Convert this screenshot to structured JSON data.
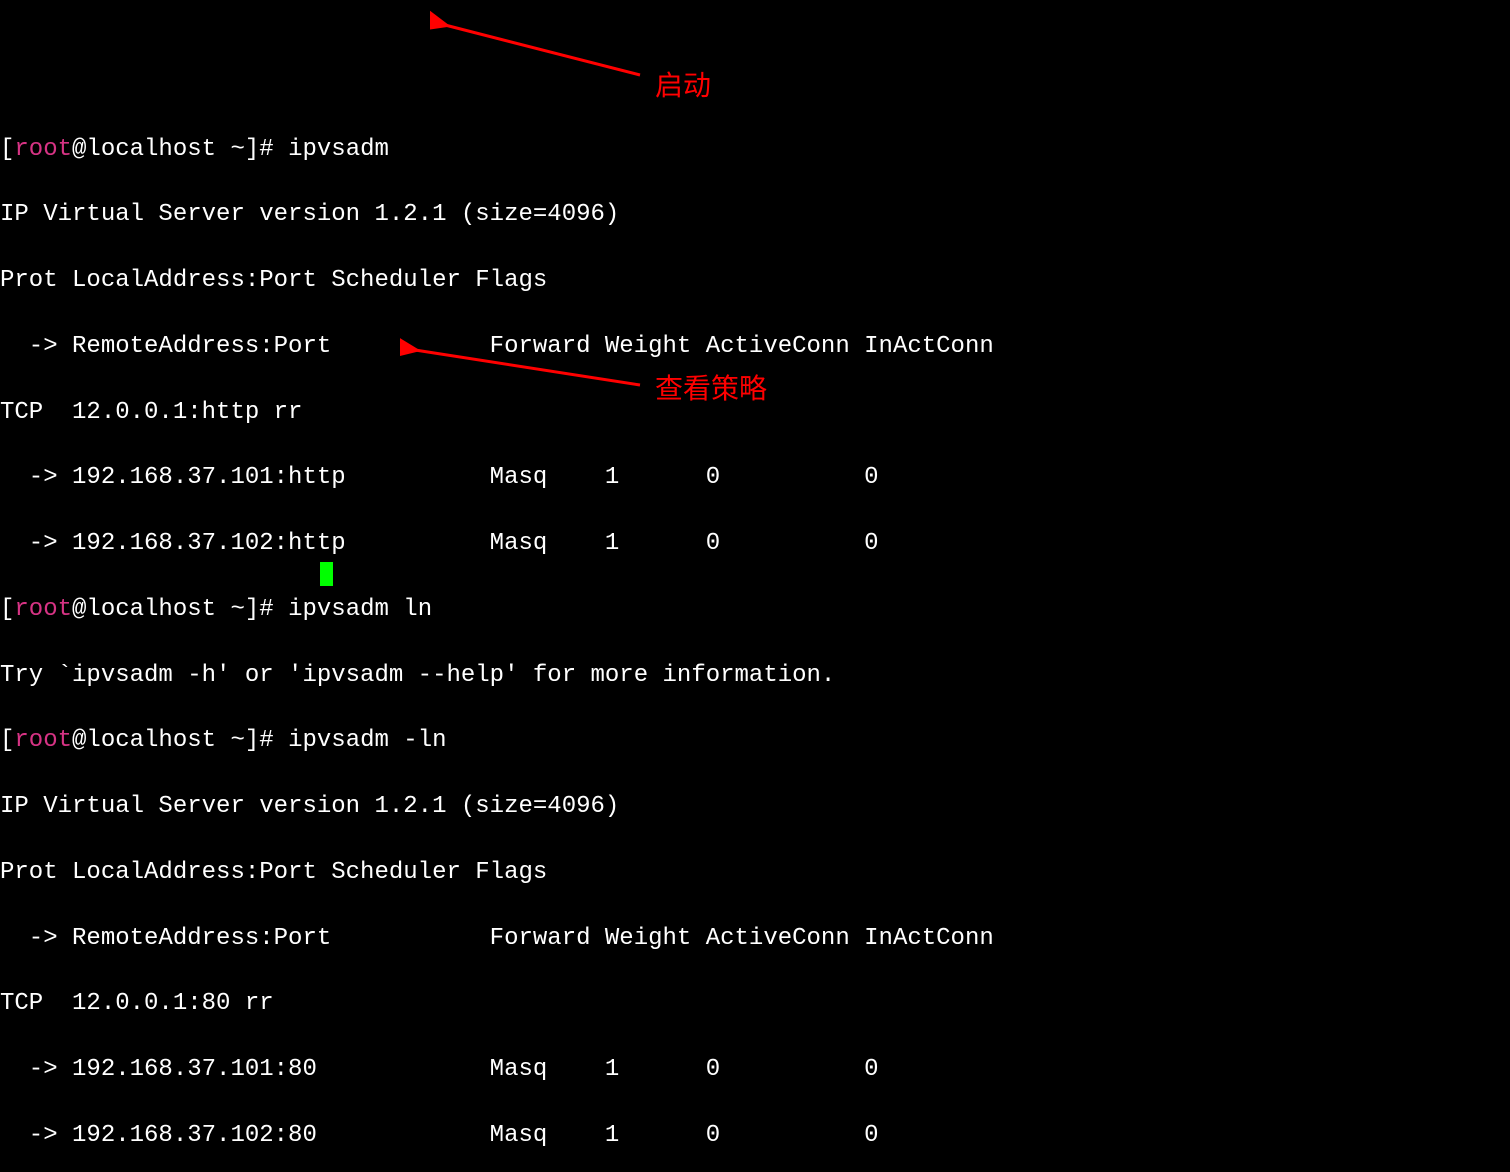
{
  "prompt": {
    "lbracket": "[",
    "user": "root",
    "at": "@",
    "host": "localhost",
    "space": " ",
    "path": "~",
    "rbracket": "]",
    "symbol": "# "
  },
  "cmd1": "ipvsadm",
  "out1_l1": "IP Virtual Server version 1.2.1 (size=4096)",
  "out1_l2": "Prot LocalAddress:Port Scheduler Flags",
  "out1_l3": "  -> RemoteAddress:Port           Forward Weight ActiveConn InActConn",
  "out1_l4": "TCP  12.0.0.1:http rr",
  "out1_l5": "  -> 192.168.37.101:http          Masq    1      0          0         ",
  "out1_l6": "  -> 192.168.37.102:http          Masq    1      0          0         ",
  "cmd2": "ipvsadm ln",
  "out2_l1": "Try `ipvsadm -h' or 'ipvsadm --help' for more information.",
  "cmd3": "ipvsadm -ln",
  "out3_l1": "IP Virtual Server version 1.2.1 (size=4096)",
  "out3_l2": "Prot LocalAddress:Port Scheduler Flags",
  "out3_l3": "  -> RemoteAddress:Port           Forward Weight ActiveConn InActConn",
  "out3_l4": "TCP  12.0.0.1:80 rr",
  "out3_l5": "  -> 192.168.37.101:80            Masq    1      0          0         ",
  "out3_l6": "  -> 192.168.37.102:80            Masq    1      0          0         ",
  "annotation1": "启动",
  "annotation2": "查看策略"
}
